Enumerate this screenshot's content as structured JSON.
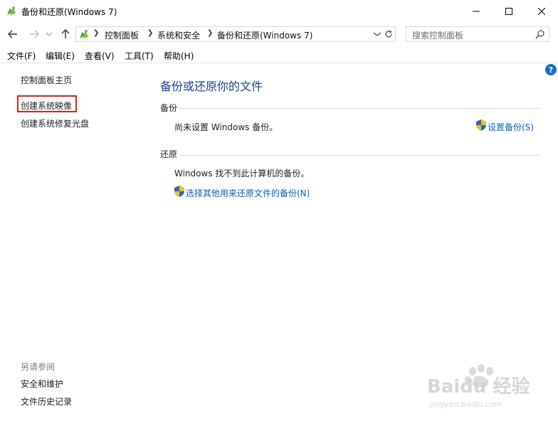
{
  "window": {
    "title": "备份和还原(Windows 7)"
  },
  "address": {
    "crumbs": [
      "控制面板",
      "系统和安全",
      "备份和还原(Windows 7)"
    ]
  },
  "search": {
    "placeholder": "搜索控制面板"
  },
  "menu": {
    "items": [
      "文件(F)",
      "编辑(E)",
      "查看(V)",
      "工具(T)",
      "帮助(H)"
    ]
  },
  "sidebar": {
    "home": "控制面板主页",
    "create_image": "创建系统映像",
    "create_disc": "创建系统修复光盘",
    "see_also_title": "另请参阅",
    "see_also": [
      "安全和维护",
      "文件历史记录"
    ]
  },
  "main": {
    "title": "备份或还原你的文件",
    "help": "?",
    "backup": {
      "label": "备份",
      "status": "尚未设置 Windows 备份。",
      "action": "设置备份(S)"
    },
    "restore": {
      "label": "还原",
      "status": "Windows 找不到此计算机的备份。",
      "action": "选择其他用来还原文件的备份(N)"
    }
  },
  "watermark": {
    "text": "Baidu 经验",
    "url": "jingyan.baidu.com"
  },
  "colors": {
    "title_blue": "#1a3f8f",
    "link_blue": "#0b5fb8",
    "highlight_red": "#e02020"
  }
}
